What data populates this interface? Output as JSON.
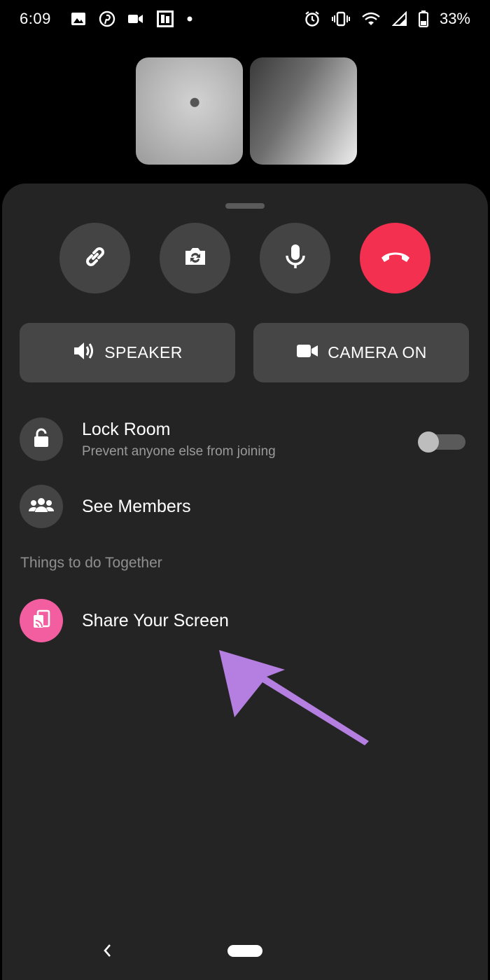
{
  "status_bar": {
    "time": "6:09",
    "battery": "33%",
    "left_icons": [
      "image-icon",
      "pinterest-icon",
      "video-icon",
      "photo-icon",
      "dot-icon"
    ],
    "right_icons": [
      "alarm-icon",
      "vibrate-icon",
      "wifi-icon",
      "signal-icon",
      "battery-icon"
    ]
  },
  "controls": {
    "circle_buttons": [
      "link-icon",
      "flip-camera-icon",
      "microphone-icon",
      "end-call-icon"
    ],
    "speaker_label": "SPEAKER",
    "camera_label": "CAMERA ON"
  },
  "options": {
    "lock_room_title": "Lock Room",
    "lock_room_sub": "Prevent anyone else from joining",
    "lock_room_enabled": false,
    "see_members": "See Members",
    "section_label": "Things to do Together",
    "share_screen": "Share Your Screen"
  },
  "colors": {
    "end_call": "#f3304f",
    "share_icon_bg": "#f25ea0",
    "arrow": "#b47fe0",
    "sheet_bg": "#242424"
  }
}
